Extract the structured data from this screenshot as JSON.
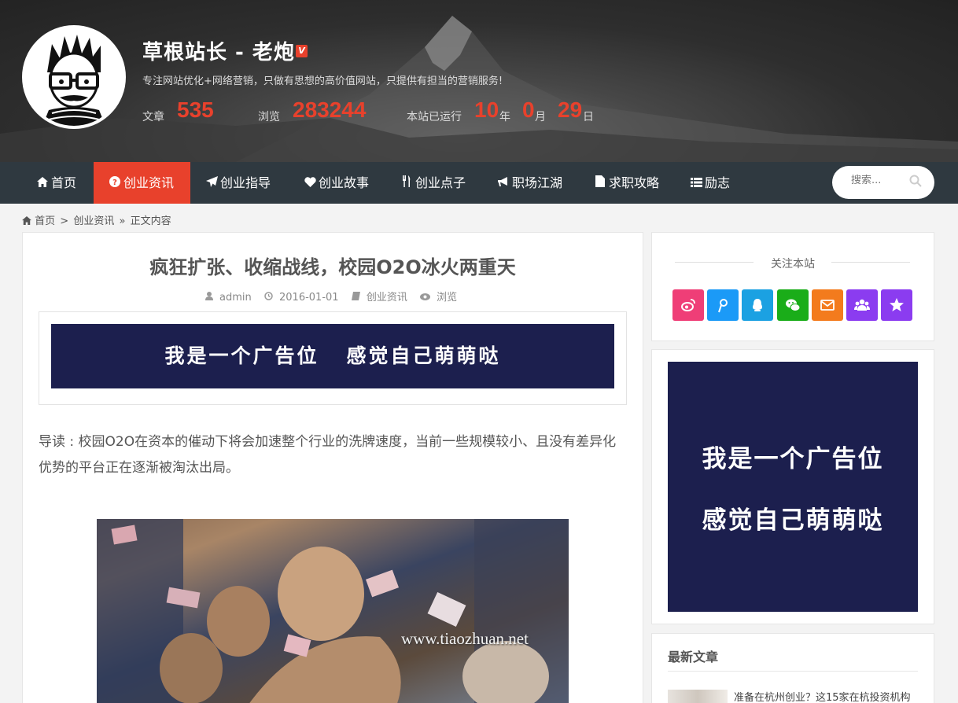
{
  "header": {
    "site_title": "草根站长 - 老炮",
    "verified_badge": "V",
    "description": "专注网站优化+网络营销，只做有思想的高价值网站，只提供有担当的营销服务!",
    "stats": {
      "articles_label": "文章",
      "articles_value": "535",
      "views_label": "浏览",
      "views_value": "283244",
      "uptime_label": "本站已运行",
      "years": "10",
      "years_unit": "年",
      "months": "0",
      "months_unit": "月",
      "days": "29",
      "days_unit": "日"
    }
  },
  "nav": {
    "items": [
      {
        "label": "首页",
        "icon": "home-icon"
      },
      {
        "label": "创业资讯",
        "icon": "question-circle-icon",
        "active": true
      },
      {
        "label": "创业指导",
        "icon": "paper-plane-icon"
      },
      {
        "label": "创业故事",
        "icon": "heart-icon"
      },
      {
        "label": "创业点子",
        "icon": "cutlery-icon"
      },
      {
        "label": "职场江湖",
        "icon": "bullhorn-icon"
      },
      {
        "label": "求职攻略",
        "icon": "file-icon"
      },
      {
        "label": "励志",
        "icon": "list-icon"
      }
    ],
    "search_placeholder": "搜索..."
  },
  "breadcrumb": {
    "home": "首页",
    "sep1": ">",
    "category": "创业资讯",
    "sep2": "»",
    "current": "正文内容"
  },
  "post": {
    "title": "疯狂扩张、收缩战线，校园O2O冰火两重天",
    "author": "admin",
    "date": "2016-01-01",
    "category": "创业资讯",
    "views_label": "浏览",
    "ad_text": "我是一个广告位   感觉自己萌萌哒",
    "lead": "导读 : 校园O2O在资本的催动下将会加速整个行业的洗牌速度，当前一些规模较小、且没有差异化优势的平台正在逐渐被淘汰出局。",
    "image_watermark": "www.tiaozhuan.net"
  },
  "sidebar": {
    "follow_title": "关注本站",
    "social": [
      {
        "name": "weibo-icon",
        "color": "#ef3e77"
      },
      {
        "name": "tencent-weibo-icon",
        "color": "#1b9af7"
      },
      {
        "name": "qq-icon",
        "color": "#1ba1e2"
      },
      {
        "name": "wechat-icon",
        "color": "#1aad19"
      },
      {
        "name": "email-icon",
        "color": "#f37b1d"
      },
      {
        "name": "qq-group-icon",
        "color": "#8b3cf0"
      },
      {
        "name": "favorite-star-icon",
        "color": "#8b3cf0"
      }
    ],
    "ad_line1": "我是一个广告位",
    "ad_line2": "感觉自己萌萌哒",
    "latest_title": "最新文章",
    "latest_items": [
      "准备在杭州创业？这15家在杭投资机构"
    ]
  },
  "colors": {
    "accent": "#e8412c",
    "nav_bg": "#2f3940",
    "ad_bg": "#1c1f4e"
  }
}
